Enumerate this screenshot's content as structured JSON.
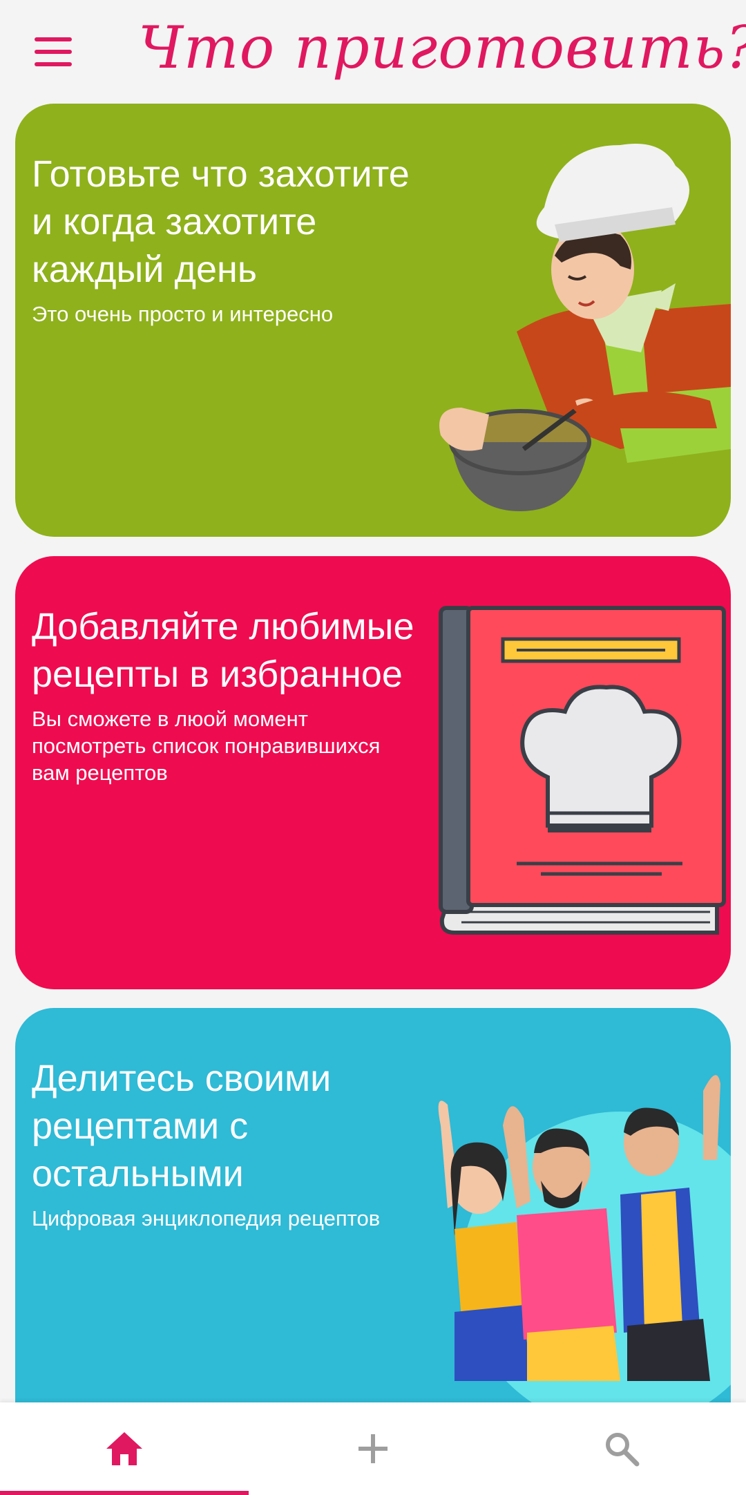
{
  "app_bar": {
    "title": "Что приготовить?",
    "menu_icon": "hamburger-menu-icon"
  },
  "cards": [
    {
      "title": "Готовьте что захотите и когда захотите каждый день",
      "subtitle": "Это очень просто и интересно",
      "background": "#8fb11b",
      "illustration": "chef-cooking-illustration"
    },
    {
      "title": "Добавляйте любимые рецепты в избранное",
      "subtitle": "Вы сможете в люой момент посмотреть список понравившихся вам рецептов",
      "background": "#ef0b4f",
      "illustration": "cookbook-illustration"
    },
    {
      "title": "Делитесь своими рецептами с остальными",
      "subtitle": "Цифровая энциклопедия рецептов",
      "background": "#2fbad6",
      "illustration": "people-waving-illustration"
    }
  ],
  "bottom_nav": {
    "items": [
      {
        "icon": "home-icon",
        "active": true
      },
      {
        "icon": "add-icon",
        "active": false
      },
      {
        "icon": "search-icon",
        "active": false
      }
    ],
    "active_color": "#e0185f",
    "inactive_color": "#9e9e9e"
  },
  "colors": {
    "accent": "#e0185f"
  }
}
